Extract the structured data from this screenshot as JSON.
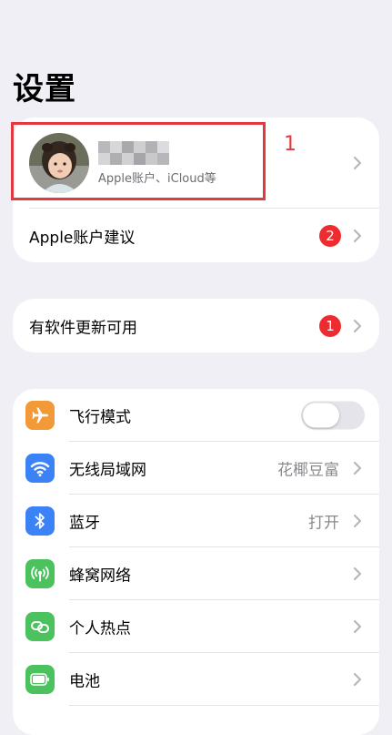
{
  "page": {
    "title": "设置"
  },
  "account": {
    "subtitle": "Apple账户、iCloud等",
    "suggestion_label": "Apple账户建议",
    "suggestion_badge": "2"
  },
  "annotation": {
    "label": "1"
  },
  "update": {
    "label": "有软件更新可用",
    "badge": "1"
  },
  "settings": {
    "airplane": {
      "label": "飞行模式",
      "icon": "airplane-icon",
      "toggle_on": false,
      "color": "#f29a38"
    },
    "wifi": {
      "label": "无线局域网",
      "value": "花椰豆富",
      "icon": "wifi-icon",
      "color": "#3a82f6"
    },
    "bluetooth": {
      "label": "蓝牙",
      "value": "打开",
      "icon": "bluetooth-icon",
      "color": "#3a82f6"
    },
    "cellular": {
      "label": "蜂窝网络",
      "icon": "cellular-icon",
      "color": "#4cc25e"
    },
    "hotspot": {
      "label": "个人热点",
      "icon": "hotspot-icon",
      "color": "#4cc25e"
    },
    "battery": {
      "label": "电池",
      "icon": "battery-icon",
      "color": "#4cc25e"
    }
  },
  "colors": {
    "background": "#f0eff5",
    "badge": "#ee2b2f",
    "annotation": "#e4383f"
  }
}
